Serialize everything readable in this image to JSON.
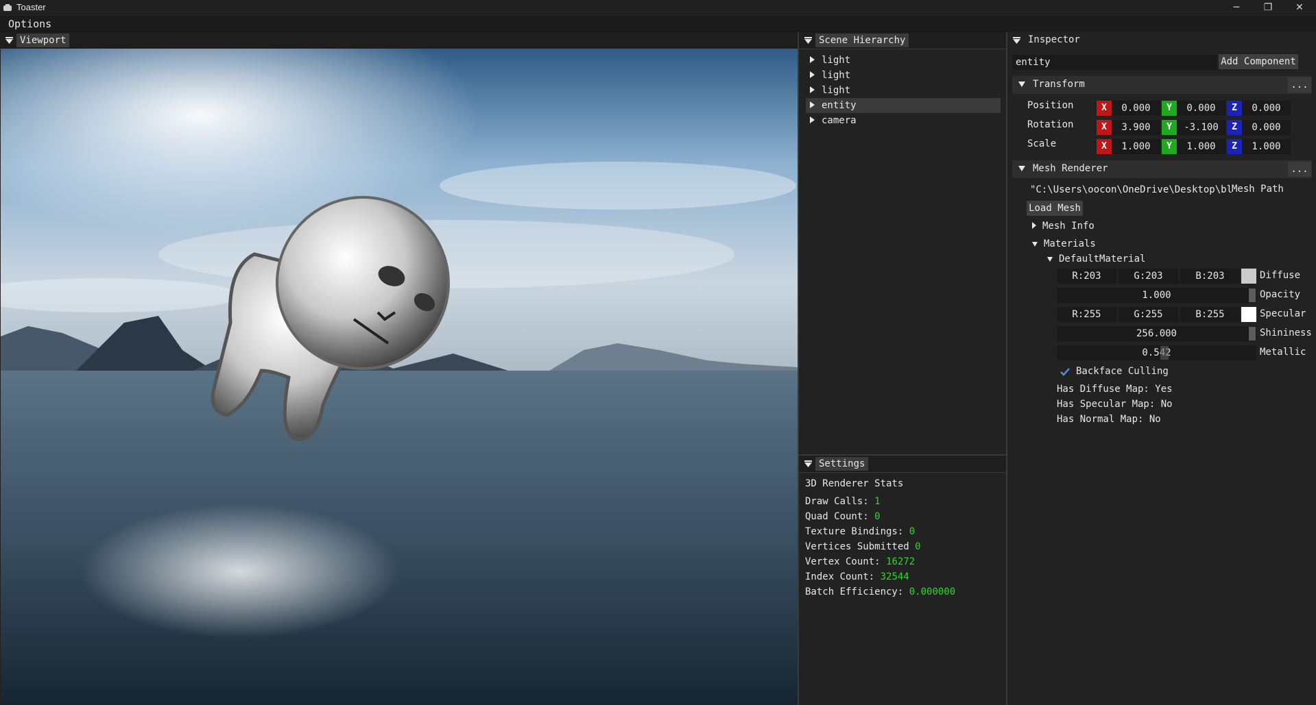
{
  "window": {
    "title": "Toaster",
    "buttons": {
      "minimize": "─",
      "maximize": "❐",
      "close": "✕"
    }
  },
  "menu": {
    "options": "Options"
  },
  "viewport": {
    "tab": "Viewport"
  },
  "hierarchy": {
    "tab": "Scene Hierarchy",
    "items": [
      {
        "label": "light"
      },
      {
        "label": "light"
      },
      {
        "label": "light"
      },
      {
        "label": "entity",
        "selected": true
      },
      {
        "label": "camera"
      }
    ]
  },
  "settings": {
    "tab": "Settings",
    "section_title": "3D Renderer Stats",
    "stats": [
      {
        "label": "Draw Calls:",
        "value": "1"
      },
      {
        "label": "Quad Count:",
        "value": "0"
      },
      {
        "label": "Texture Bindings:",
        "value": "0"
      },
      {
        "label": "Vertices Submitted",
        "value": "0"
      },
      {
        "label": "Vertex Count:",
        "value": "16272"
      },
      {
        "label": "Index Count:",
        "value": "32544"
      },
      {
        "label": "Batch Efficiency:",
        "value": "0.000000"
      }
    ],
    "value_color": "#31d62b"
  },
  "inspector": {
    "tab": "Inspector",
    "entity_name": "entity",
    "add_component": "Add Component",
    "transform": {
      "title": "Transform",
      "menu": "...",
      "rows": [
        {
          "label": "Position",
          "x": "0.000",
          "y": "0.000",
          "z": "0.000"
        },
        {
          "label": "Rotation",
          "x": "3.900",
          "y": "-3.100",
          "z": "0.000"
        },
        {
          "label": "Scale",
          "x": "1.000",
          "y": "1.000",
          "z": "1.000"
        }
      ],
      "axis_labels": {
        "x": "X",
        "y": "Y",
        "z": "Z"
      }
    },
    "mesh_renderer": {
      "title": "Mesh Renderer",
      "menu": "...",
      "mesh_path_value": "\"C:\\Users\\oocon\\OneDrive\\Desktop\\bl‹",
      "mesh_path_label": "Mesh Path",
      "load_mesh": "Load Mesh",
      "mesh_info": "Mesh Info",
      "materials": "Materials",
      "default_material": "DefaultMaterial",
      "diffuse": {
        "r": "R:203",
        "g": "G:203",
        "b": "B:203",
        "label": "Diffuse",
        "color": "#cbcbcb"
      },
      "opacity": {
        "value": "1.000",
        "label": "Opacity"
      },
      "specular": {
        "r": "R:255",
        "g": "G:255",
        "b": "B:255",
        "label": "Specular",
        "color": "#ffffff"
      },
      "shininess": {
        "value": "256.000",
        "label": "Shininess"
      },
      "metallic": {
        "value": "0.542",
        "label": "Metallic"
      },
      "backface_culling": {
        "label": "Backface Culling",
        "checked": true
      },
      "info": [
        "Has Diffuse Map: Yes",
        "Has Specular Map: No",
        "Has Normal Map: No"
      ]
    }
  }
}
